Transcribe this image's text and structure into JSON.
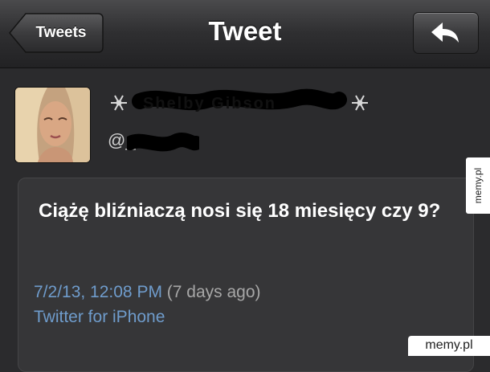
{
  "nav": {
    "back_label": "Tweets",
    "title": "Tweet",
    "reply_icon": "reply-arrow-icon"
  },
  "user": {
    "display_name": "Shelby Gibson",
    "handle_prefix": "@_",
    "name_decoration_icon": "snowflake-icon"
  },
  "tweet": {
    "text": "Ciążę bliźniaczą nosi się 18 miesięcy czy 9?",
    "date": "7/2/13, 12:08 PM",
    "relative_time": "(7 days ago)",
    "source": "Twitter for iPhone"
  },
  "watermark": {
    "side": "memy.pl",
    "corner": "memy.pl"
  },
  "colors": {
    "background": "#2b2b2d",
    "card": "#363638",
    "link_blue": "#6f9ccc",
    "muted_gray": "#a7a7a7"
  }
}
